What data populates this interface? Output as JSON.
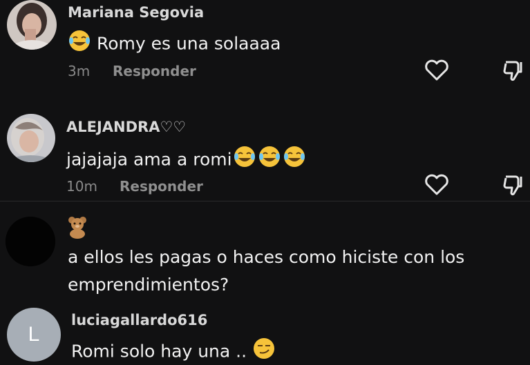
{
  "comments": [
    {
      "username": "Mariana Segovia",
      "text": "Romy es una solaaaa",
      "time": "3m",
      "reply_label": "Responder"
    },
    {
      "username": "ALEJANDRA♡♡",
      "text": "jajajaja ama a romi",
      "time": "10m",
      "reply_label": "Responder"
    },
    {
      "username": "🧸",
      "text_line1": "a ellos les pagas o haces como hiciste con los",
      "text_line2": "emprendimientos?"
    },
    {
      "username": "luciagallardo616",
      "avatar_letter": "L",
      "text": "Romi solo hay una .."
    }
  ],
  "colors": {
    "background": "#111112",
    "avatar_letter_bg": "#a7aeb6"
  }
}
